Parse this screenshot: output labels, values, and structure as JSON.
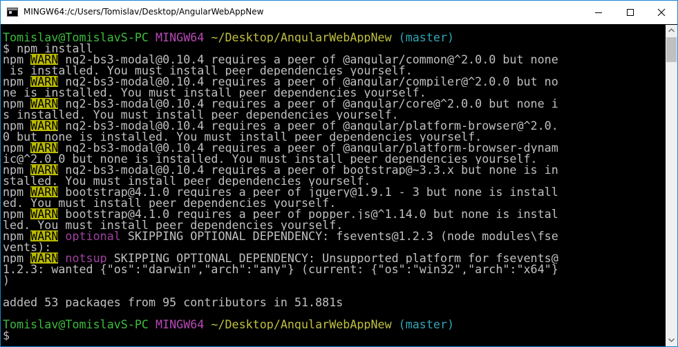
{
  "window": {
    "title": "MINGW64:/c/Users/Tomislav/Desktop/AngularWebAppNew",
    "icon": "terminal-icon",
    "controls": [
      "minimize-icon",
      "maximize-icon",
      "close-icon"
    ]
  },
  "colors": {
    "background": "#000000",
    "text": "#c0c0c0",
    "prompt_user": "#3ebd3e",
    "prompt_host": "#b848b8",
    "prompt_path": "#c0c040",
    "prompt_branch": "#2ea8b8",
    "warn_background": "#bbbb00"
  },
  "terminal": {
    "lines": [
      {
        "segs": [
          {
            "t": "Tomislav@TomislavS-PC",
            "c": "green"
          },
          {
            "t": " ",
            "c": "white"
          },
          {
            "t": "MINGW64",
            "c": "magenta"
          },
          {
            "t": " ",
            "c": "white"
          },
          {
            "t": "~/Desktop/AngularWebAppNew",
            "c": "yellow"
          },
          {
            "t": " ",
            "c": "white"
          },
          {
            "t": "(master)",
            "c": "cyan"
          }
        ]
      },
      {
        "segs": [
          {
            "t": "$ npm install",
            "c": "white"
          }
        ]
      },
      {
        "segs": [
          {
            "t": "npm ",
            "c": "white"
          },
          {
            "t": "WARN",
            "c": "warn"
          },
          {
            "t": " ng2-bs3-modal@0.10.4 requires a peer of @angular/common@^2.0.0 but none",
            "c": "white"
          }
        ]
      },
      {
        "segs": [
          {
            "t": " is installed. You must install peer dependencies yourself.",
            "c": "white"
          }
        ]
      },
      {
        "segs": [
          {
            "t": "npm ",
            "c": "white"
          },
          {
            "t": "WARN",
            "c": "warn"
          },
          {
            "t": " ng2-bs3-modal@0.10.4 requires a peer of @angular/compiler@^2.0.0 but no",
            "c": "white"
          }
        ]
      },
      {
        "segs": [
          {
            "t": "ne is installed. You must install peer dependencies yourself.",
            "c": "white"
          }
        ]
      },
      {
        "segs": [
          {
            "t": "npm ",
            "c": "white"
          },
          {
            "t": "WARN",
            "c": "warn"
          },
          {
            "t": " ng2-bs3-modal@0.10.4 requires a peer of @angular/core@^2.0.0 but none i",
            "c": "white"
          }
        ]
      },
      {
        "segs": [
          {
            "t": "s installed. You must install peer dependencies yourself.",
            "c": "white"
          }
        ]
      },
      {
        "segs": [
          {
            "t": "npm ",
            "c": "white"
          },
          {
            "t": "WARN",
            "c": "warn"
          },
          {
            "t": " ng2-bs3-modal@0.10.4 requires a peer of @angular/platform-browser@^2.0.",
            "c": "white"
          }
        ]
      },
      {
        "segs": [
          {
            "t": "0 but none is installed. You must install peer dependencies yourself.",
            "c": "white"
          }
        ]
      },
      {
        "segs": [
          {
            "t": "npm ",
            "c": "white"
          },
          {
            "t": "WARN",
            "c": "warn"
          },
          {
            "t": " ng2-bs3-modal@0.10.4 requires a peer of @angular/platform-browser-dynam",
            "c": "white"
          }
        ]
      },
      {
        "segs": [
          {
            "t": "ic@^2.0.0 but none is installed. You must install peer dependencies yourself.",
            "c": "white"
          }
        ]
      },
      {
        "segs": [
          {
            "t": "npm ",
            "c": "white"
          },
          {
            "t": "WARN",
            "c": "warn"
          },
          {
            "t": " ng2-bs3-modal@0.10.4 requires a peer of bootstrap@~3.3.x but none is in",
            "c": "white"
          }
        ]
      },
      {
        "segs": [
          {
            "t": "stalled. You must install peer dependencies yourself.",
            "c": "white"
          }
        ]
      },
      {
        "segs": [
          {
            "t": "npm ",
            "c": "white"
          },
          {
            "t": "WARN",
            "c": "warn"
          },
          {
            "t": " bootstrap@4.1.0 requires a peer of jquery@1.9.1 - 3 but none is install",
            "c": "white"
          }
        ]
      },
      {
        "segs": [
          {
            "t": "ed. You must install peer dependencies yourself.",
            "c": "white"
          }
        ]
      },
      {
        "segs": [
          {
            "t": "npm ",
            "c": "white"
          },
          {
            "t": "WARN",
            "c": "warn"
          },
          {
            "t": " bootstrap@4.1.0 requires a peer of popper.js@^1.14.0 but none is instal",
            "c": "white"
          }
        ]
      },
      {
        "segs": [
          {
            "t": "led. You must install peer dependencies yourself.",
            "c": "white"
          }
        ]
      },
      {
        "segs": [
          {
            "t": "npm ",
            "c": "white"
          },
          {
            "t": "WARN",
            "c": "warn"
          },
          {
            "t": " ",
            "c": "white"
          },
          {
            "t": "optional",
            "c": "violet"
          },
          {
            "t": " SKIPPING OPTIONAL DEPENDENCY: fsevents@1.2.3 (node_modules\\fse",
            "c": "white"
          }
        ]
      },
      {
        "segs": [
          {
            "t": "vents):",
            "c": "white"
          }
        ]
      },
      {
        "segs": [
          {
            "t": "npm ",
            "c": "white"
          },
          {
            "t": "WARN",
            "c": "warn"
          },
          {
            "t": " ",
            "c": "white"
          },
          {
            "t": "notsup",
            "c": "violet"
          },
          {
            "t": " SKIPPING OPTIONAL DEPENDENCY: Unsupported platform for fsevents@",
            "c": "white"
          }
        ]
      },
      {
        "segs": [
          {
            "t": "1.2.3: wanted {\"os\":\"darwin\",\"arch\":\"any\"} (current: {\"os\":\"win32\",\"arch\":\"x64\"}",
            "c": "white"
          }
        ]
      },
      {
        "segs": [
          {
            "t": ")",
            "c": "white"
          }
        ]
      },
      {
        "segs": [
          {
            "t": "",
            "c": "white"
          }
        ]
      },
      {
        "segs": [
          {
            "t": "added 53 packages from 95 contributors in 51.881s",
            "c": "white"
          }
        ]
      },
      {
        "segs": [
          {
            "t": "",
            "c": "white"
          }
        ]
      },
      {
        "segs": [
          {
            "t": "Tomislav@TomislavS-PC",
            "c": "green"
          },
          {
            "t": " ",
            "c": "white"
          },
          {
            "t": "MINGW64",
            "c": "magenta"
          },
          {
            "t": " ",
            "c": "white"
          },
          {
            "t": "~/Desktop/AngularWebAppNew",
            "c": "yellow"
          },
          {
            "t": " ",
            "c": "white"
          },
          {
            "t": "(master)",
            "c": "cyan"
          }
        ]
      },
      {
        "segs": [
          {
            "t": "$ ",
            "c": "white"
          }
        ]
      }
    ]
  },
  "scrollbar": {
    "up_icon": "scroll-up-arrow-icon",
    "down_icon": "scroll-down-arrow-icon"
  }
}
